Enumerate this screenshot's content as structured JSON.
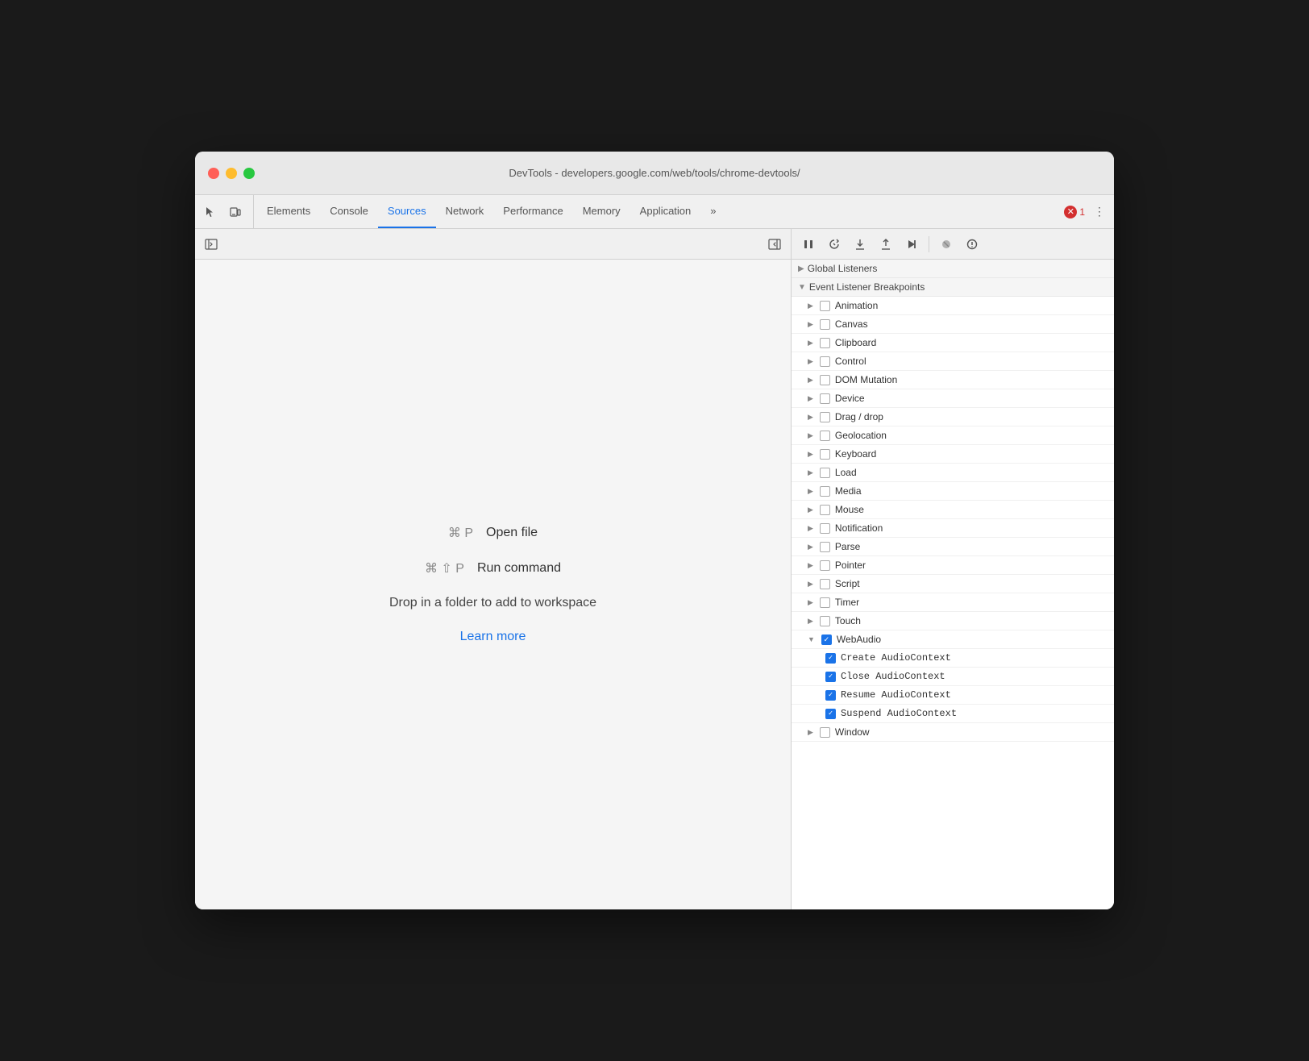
{
  "window": {
    "title": "DevTools - developers.google.com/web/tools/chrome-devtools/"
  },
  "tabs": [
    {
      "id": "elements",
      "label": "Elements",
      "active": false
    },
    {
      "id": "console",
      "label": "Console",
      "active": false
    },
    {
      "id": "sources",
      "label": "Sources",
      "active": true
    },
    {
      "id": "network",
      "label": "Network",
      "active": false
    },
    {
      "id": "performance",
      "label": "Performance",
      "active": false
    },
    {
      "id": "memory",
      "label": "Memory",
      "active": false
    },
    {
      "id": "application",
      "label": "Application",
      "active": false
    }
  ],
  "error_count": "1",
  "shortcuts": [
    {
      "keys": "⌘ P",
      "label": "Open file"
    },
    {
      "keys": "⌘ ⇧ P",
      "label": "Run command"
    }
  ],
  "workspace_text": "Drop in a folder to add to workspace",
  "learn_more": "Learn more",
  "breakpoints_section": "Event Listener Breakpoints",
  "global_listeners": "Global Listeners",
  "breakpoint_items": [
    {
      "id": "animation",
      "label": "Animation",
      "checked": false,
      "expanded": false
    },
    {
      "id": "canvas",
      "label": "Canvas",
      "checked": false,
      "expanded": false
    },
    {
      "id": "clipboard",
      "label": "Clipboard",
      "checked": false,
      "expanded": false
    },
    {
      "id": "control",
      "label": "Control",
      "checked": false,
      "expanded": false
    },
    {
      "id": "dom-mutation",
      "label": "DOM Mutation",
      "checked": false,
      "expanded": false
    },
    {
      "id": "device",
      "label": "Device",
      "checked": false,
      "expanded": false
    },
    {
      "id": "drag-drop",
      "label": "Drag / drop",
      "checked": false,
      "expanded": false
    },
    {
      "id": "geolocation",
      "label": "Geolocation",
      "checked": false,
      "expanded": false
    },
    {
      "id": "keyboard",
      "label": "Keyboard",
      "checked": false,
      "expanded": false
    },
    {
      "id": "load",
      "label": "Load",
      "checked": false,
      "expanded": false
    },
    {
      "id": "media",
      "label": "Media",
      "checked": false,
      "expanded": false
    },
    {
      "id": "mouse",
      "label": "Mouse",
      "checked": false,
      "expanded": false
    },
    {
      "id": "notification",
      "label": "Notification",
      "checked": false,
      "expanded": false
    },
    {
      "id": "parse",
      "label": "Parse",
      "checked": false,
      "expanded": false
    },
    {
      "id": "pointer",
      "label": "Pointer",
      "checked": false,
      "expanded": false
    },
    {
      "id": "script",
      "label": "Script",
      "checked": false,
      "expanded": false
    },
    {
      "id": "timer",
      "label": "Timer",
      "checked": false,
      "expanded": false
    },
    {
      "id": "touch",
      "label": "Touch",
      "checked": false,
      "expanded": false
    },
    {
      "id": "webaudio",
      "label": "WebAudio",
      "checked": true,
      "expanded": true
    },
    {
      "id": "window",
      "label": "Window",
      "checked": false,
      "expanded": false
    }
  ],
  "webaudio_subitems": [
    "Create AudioContext",
    "Close AudioContext",
    "Resume AudioContext",
    "Suspend AudioContext"
  ]
}
